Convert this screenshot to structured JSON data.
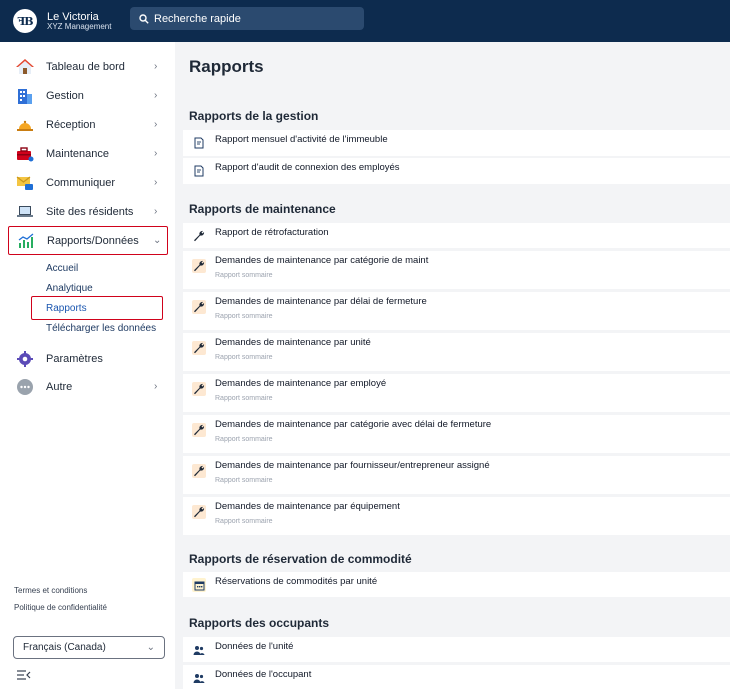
{
  "header": {
    "logo_text": "ꟻB",
    "brand_name": "Le Victoria",
    "brand_sub": "XYZ Management",
    "search_placeholder": "Recherche rapide"
  },
  "sidebar": {
    "items": [
      {
        "label": "Tableau de bord",
        "icon": "house-icon"
      },
      {
        "label": "Gestion",
        "icon": "building-icon"
      },
      {
        "label": "Réception",
        "icon": "service-bell-icon"
      },
      {
        "label": "Maintenance",
        "icon": "toolbox-icon"
      },
      {
        "label": "Communiquer",
        "icon": "envelope-chat-icon"
      },
      {
        "label": "Site des résidents",
        "icon": "laptop-icon"
      },
      {
        "label": "Rapports/Données",
        "icon": "chart-icon"
      },
      {
        "label": "Paramètres",
        "icon": "gear-icon"
      },
      {
        "label": "Autre",
        "icon": "more-icon"
      }
    ],
    "subitems": [
      "Accueil",
      "Analytique",
      "Rapports",
      "Télécharger les données"
    ],
    "footer_links": [
      "Termes et conditions",
      "Politique de confidentialité"
    ],
    "language": "Français (Canada)"
  },
  "main": {
    "title": "Rapports",
    "sections": [
      {
        "title": "Rapports de la gestion",
        "items": [
          {
            "title": "Rapport mensuel d'activité de l'immeuble",
            "subtitle": ""
          },
          {
            "title": "Rapport d'audit de connexion des employés",
            "subtitle": ""
          }
        ]
      },
      {
        "title": "Rapports de maintenance",
        "items": [
          {
            "title": "Rapport de rétrofacturation",
            "subtitle": ""
          },
          {
            "title": "Demandes de maintenance par catégorie de maint",
            "subtitle": "Rapport sommaire"
          },
          {
            "title": "Demandes de maintenance par délai de fermeture",
            "subtitle": "Rapport sommaire"
          },
          {
            "title": "Demandes de maintenance par unité",
            "subtitle": "Rapport sommaire"
          },
          {
            "title": "Demandes de maintenance par employé",
            "subtitle": "Rapport sommaire"
          },
          {
            "title": "Demandes de maintenance par catégorie avec délai de fermeture",
            "subtitle": "Rapport sommaire"
          },
          {
            "title": "Demandes de maintenance par fournisseur/entrepreneur assigné",
            "subtitle": "Rapport sommaire"
          },
          {
            "title": "Demandes de maintenance par équipement",
            "subtitle": "Rapport sommaire"
          }
        ]
      },
      {
        "title": "Rapports de réservation de commodité",
        "items": [
          {
            "title": "Réservations de commodités par unité",
            "subtitle": ""
          }
        ]
      },
      {
        "title": "Rapports des occupants",
        "items": [
          {
            "title": "Données de l'unité",
            "subtitle": ""
          },
          {
            "title": "Données de l'occupant",
            "subtitle": ""
          }
        ]
      }
    ]
  }
}
